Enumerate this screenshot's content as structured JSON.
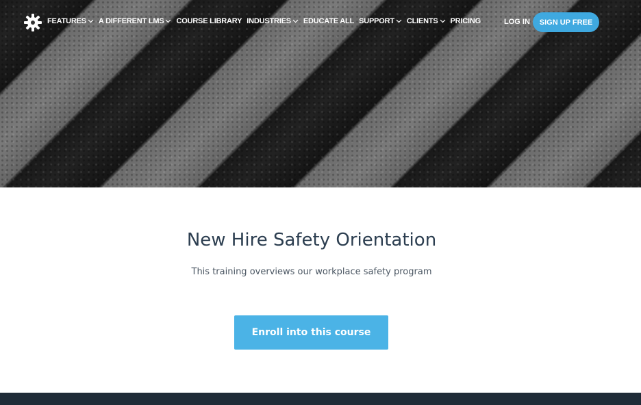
{
  "nav": {
    "items": [
      {
        "label": "FEATURES",
        "dropdown": true
      },
      {
        "label": "A DIFFERENT LMS",
        "dropdown": true
      },
      {
        "label": "COURSE LIBRARY",
        "dropdown": false
      },
      {
        "label": "INDUSTRIES",
        "dropdown": true
      },
      {
        "label": "EDUCATE ALL",
        "dropdown": false
      },
      {
        "label": "SUPPORT",
        "dropdown": true
      },
      {
        "label": "CLIENTS",
        "dropdown": true
      },
      {
        "label": "PRICING",
        "dropdown": false
      }
    ],
    "login": "LOG IN",
    "signup": "SIGN UP FREE"
  },
  "course": {
    "title": "New Hire Safety Orientation",
    "description": "This training overviews our workplace safety program",
    "enroll_label": "Enroll into this course"
  },
  "colors": {
    "accent": "#3fa9e0",
    "footer": "#1f2b37",
    "title_text": "#2c3e50"
  },
  "icons": {
    "logo": "gear-flower-logo",
    "dropdown": "chevron-down-icon"
  }
}
